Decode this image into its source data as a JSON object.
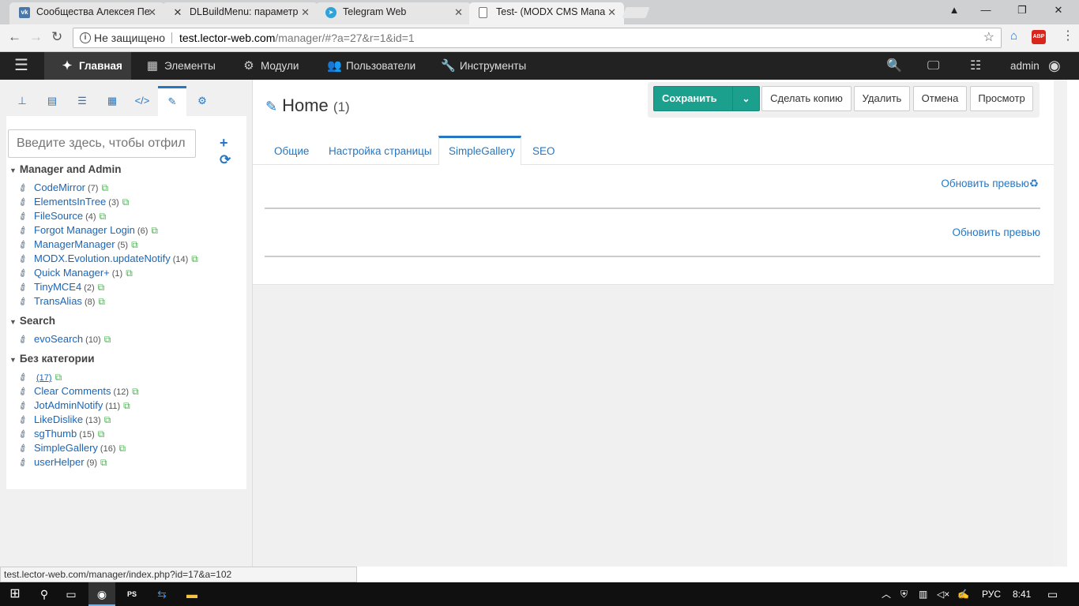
{
  "browser": {
    "tabs": [
      {
        "title": "Сообщества Алексея Пе",
        "favicon": "vk-icon",
        "color": "#4a76a8"
      },
      {
        "title": "DLBuildMenu: параметр",
        "favicon": "modx-icon",
        "color": "#333333"
      },
      {
        "title": "Telegram Web",
        "favicon": "telegram-icon",
        "color": "#2fa3d9"
      },
      {
        "title": "Test- (MODX CMS Mana",
        "favicon": "page-icon",
        "color": "#777777"
      }
    ],
    "insecure_label": "Не защищено",
    "url_host": "test.lector-web.com",
    "url_path": "/manager/#?a=27&r=1&id=1",
    "extension_label": "ABP"
  },
  "topnav": {
    "items": [
      "Главная",
      "Элементы",
      "Модули",
      "Пользователи",
      "Инструменты"
    ],
    "user": "admin"
  },
  "tree": {
    "filter_placeholder": "Введите здесь, чтобы отфил",
    "categories": [
      {
        "name": "Manager and Admin",
        "items": [
          {
            "name": "CodeMirror",
            "count": "(7)"
          },
          {
            "name": "ElementsInTree",
            "count": "(3)"
          },
          {
            "name": "FileSource",
            "count": "(4)"
          },
          {
            "name": "Forgot Manager Login",
            "count": "(6)"
          },
          {
            "name": "ManagerManager",
            "count": "(5)"
          },
          {
            "name": "MODX.Evolution.updateNotify",
            "count": "(14)"
          },
          {
            "name": "Quick Manager+",
            "count": "(1)"
          },
          {
            "name": "TinyMCE4",
            "count": "(2)"
          },
          {
            "name": "TransAlias",
            "count": "(8)"
          }
        ]
      },
      {
        "name": "Search",
        "items": [
          {
            "name": "evoSearch",
            "count": "(10)"
          }
        ]
      },
      {
        "name": "Без категории",
        "items": [
          {
            "name": "",
            "count": "(17)"
          },
          {
            "name": "Clear Comments",
            "count": "(12)"
          },
          {
            "name": "JotAdminNotify",
            "count": "(11)"
          },
          {
            "name": "LikeDislike",
            "count": "(13)"
          },
          {
            "name": "sgThumb",
            "count": "(15)"
          },
          {
            "name": "SimpleGallery",
            "count": "(16)"
          },
          {
            "name": "userHelper",
            "count": "(9)"
          }
        ]
      }
    ]
  },
  "page": {
    "title": "Home",
    "id": "(1)",
    "actions": {
      "save": "Сохранить",
      "copy": "Сделать копию",
      "delete": "Удалить",
      "cancel": "Отмена",
      "preview": "Просмотр"
    },
    "tabs": [
      "Общие",
      "Настройка страницы",
      "SimpleGallery",
      "SEO"
    ],
    "active_tab": "SimpleGallery",
    "refresh_label_1": "Обновить превью",
    "refresh_label_2": "Обновить превью"
  },
  "status_link": "test.lector-web.com/manager/index.php?id=17&a=102",
  "taskbar": {
    "lang": "РУС",
    "time": "8:41"
  },
  "colors": {
    "accent": "#2577c4",
    "save": "#1ba08e",
    "topnav": "#222222"
  }
}
